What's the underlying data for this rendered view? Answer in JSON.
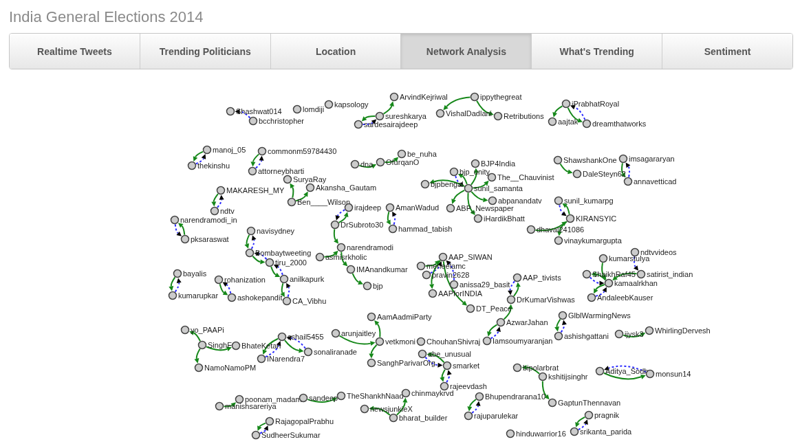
{
  "page_title": "India General Elections 2014",
  "tabs": [
    {
      "label": "Realtime Tweets",
      "selected": false
    },
    {
      "label": "Trending Politicians",
      "selected": false
    },
    {
      "label": "Location",
      "selected": false
    },
    {
      "label": "Network Analysis",
      "selected": true
    },
    {
      "label": "What's Trending",
      "selected": false
    },
    {
      "label": "Sentiment",
      "selected": false
    }
  ],
  "network": {
    "clusters": [
      {
        "label": "Shashwat014",
        "children": [
          {
            "label": "bcchristopher",
            "kind": "dashed"
          }
        ]
      },
      {
        "label": "lomdiji"
      },
      {
        "label": "kapsology"
      },
      {
        "label": "sureshkarya",
        "children": [
          {
            "label": "ArvindKejriwal",
            "kind": "solid"
          },
          {
            "label": "sardesairajdeep",
            "kind": "both"
          }
        ]
      },
      {
        "label": "ippythegreat",
        "children": [
          {
            "label": "VishalDadlani",
            "kind": "solid"
          },
          {
            "label": "Retributions",
            "kind": "solid"
          }
        ]
      },
      {
        "label": "iPrabhatRoyal",
        "children": [
          {
            "label": "aajtak",
            "kind": "solid"
          },
          {
            "label": "dreamthatworks",
            "kind": "both"
          }
        ]
      },
      {
        "label": "manoj_05",
        "children": [
          {
            "label": "thekinshu",
            "kind": "both"
          }
        ]
      },
      {
        "label": "commonm59784430",
        "children": [
          {
            "label": "attorneybharti",
            "kind": "both"
          }
        ]
      },
      {
        "label": "dna",
        "children": [
          {
            "label": "OfurqanO",
            "kind": "solid",
            "children": [
              {
                "label": "be_nuha",
                "kind": "solid"
              }
            ]
          }
        ]
      },
      {
        "label": "ShawshankOne",
        "children": [
          {
            "label": "DaleSteyn62",
            "kind": "solid"
          }
        ]
      },
      {
        "label": "imsagararyan",
        "children": [
          {
            "label": "annavetticad",
            "kind": "both"
          }
        ]
      },
      {
        "label": "MAKARESH_MY",
        "children": [
          {
            "label": "ndtv",
            "kind": "both"
          }
        ]
      },
      {
        "label": "Ben____Wilson",
        "children": [
          {
            "label": "SuryaRay",
            "kind": "solid"
          },
          {
            "label": "Akansha_Gautam",
            "kind": "solid"
          }
        ]
      },
      {
        "label": "sunil_samanta",
        "children": [
          {
            "label": "BJP4India",
            "kind": "solid"
          },
          {
            "label": "bjp_unity",
            "kind": "both"
          },
          {
            "label": "The__Chauvinist",
            "kind": "solid"
          },
          {
            "label": "bjpbengal",
            "kind": "solid"
          },
          {
            "label": "abpanandatv",
            "kind": "solid"
          },
          {
            "label": "ABP_Newspaper",
            "kind": "solid"
          },
          {
            "label": "iHardikBhatt",
            "kind": "solid"
          }
        ]
      },
      {
        "label": "pksaraswat",
        "children": [
          {
            "label": "narendramodi_in",
            "kind": "both"
          }
        ]
      },
      {
        "label": "DrSubroto30",
        "children": [
          {
            "label": "irajdeep",
            "kind": "both"
          },
          {
            "label": "narendramodi",
            "kind": "solid",
            "children": [
              {
                "label": "asmisrkholic",
                "kind": "reverse"
              },
              {
                "label": "IMAnandkumar",
                "kind": "solid",
                "children": [
                  {
                    "label": "bjp",
                    "kind": "solid"
                  }
                ]
              }
            ]
          }
        ]
      },
      {
        "label": "AmanWadud",
        "children": [
          {
            "label": "hammad_tabish",
            "kind": "both"
          }
        ]
      },
      {
        "label": "KIRANSYIC",
        "children": [
          {
            "label": "sunil_kumarpg",
            "kind": "both"
          },
          {
            "label": "dhaval241086",
            "kind": "reverse"
          },
          {
            "label": "vinaykumargupta",
            "kind": "solid"
          }
        ]
      },
      {
        "label": "bayalis",
        "children": [
          {
            "label": "kumarupkar",
            "kind": "both"
          }
        ]
      },
      {
        "label": "rohanization",
        "children": [
          {
            "label": "ashokepandit",
            "kind": "both"
          }
        ]
      },
      {
        "label": "navisydney",
        "children": [
          {
            "label": "Bombaytweeting",
            "kind": "both",
            "children": [
              {
                "label": "tiru_2000",
                "kind": "both",
                "children": [
                  {
                    "label": "anilkapurk",
                    "kind": "both",
                    "children": [
                      {
                        "label": "CA_Vibhu",
                        "kind": "both"
                      }
                    ]
                  }
                ]
              }
            ]
          }
        ]
      },
      {
        "label": "AAP_SIWAN",
        "children": [
          {
            "label": "meneelamc",
            "kind": "reverse"
          },
          {
            "label": "pravin2628",
            "kind": "dashed"
          },
          {
            "label": "anissa29_basit",
            "kind": "dashed"
          },
          {
            "label": "AAPforINDIA",
            "kind": "solid"
          },
          {
            "label": "DT_Peace",
            "kind": "solid"
          }
        ]
      },
      {
        "label": "kamaalrkhan",
        "children": [
          {
            "label": "kumarstulya",
            "kind": "reverse"
          },
          {
            "label": "ShaikhRaf45",
            "kind": "both"
          },
          {
            "label": "AndaleebKauser",
            "kind": "both"
          },
          {
            "label": "satirist_indian",
            "kind": "reverse",
            "children": [
              {
                "label": "ndtvvideos",
                "kind": "dashed"
              }
            ]
          }
        ]
      },
      {
        "label": "SinghF",
        "children": [
          {
            "label": "yo_PAAPi",
            "kind": "solid"
          },
          {
            "label": "BhateKetan",
            "kind": "solid"
          },
          {
            "label": "NamoNamoPM",
            "kind": "solid"
          }
        ]
      },
      {
        "label": "sshail5455",
        "children": [
          {
            "label": "INarendra7",
            "kind": "both"
          },
          {
            "label": "sonaliranade",
            "kind": "both"
          }
        ]
      },
      {
        "label": "arunjaitley",
        "children": [
          {
            "label": "vetkmoni",
            "kind": "solid",
            "children": [
              {
                "label": "AamAadmiParty",
                "kind": "solid"
              },
              {
                "label": "SanghParivarOrg",
                "kind": "solid"
              }
            ]
          }
        ]
      },
      {
        "label": "ChouhanShivraj"
      },
      {
        "label": "DrKumarVishwas",
        "children": [
          {
            "label": "AAP_tivists",
            "kind": "both"
          },
          {
            "label": "AzwarJahan",
            "kind": "reverse",
            "children": [
              {
                "label": "Iamsoumyaranjan",
                "kind": "both"
              }
            ]
          }
        ]
      },
      {
        "label": "GlblWarmingNews",
        "children": [
          {
            "label": "ashishgattani",
            "kind": "both"
          }
        ]
      },
      {
        "label": "ijysk3",
        "children": [
          {
            "label": "WhirlingDervesh",
            "kind": "solid"
          }
        ]
      },
      {
        "label": "smarket",
        "children": [
          {
            "label": "abe_unusual",
            "kind": "both"
          },
          {
            "label": "rajeevdash",
            "kind": "both"
          }
        ]
      },
      {
        "label": "kshitijsinghr",
        "children": [
          {
            "label": "bipolarbrat",
            "kind": "solid"
          },
          {
            "label": "GaptunThennavan",
            "kind": "solid"
          }
        ]
      },
      {
        "label": "Aditya_Sodh",
        "children": [
          {
            "label": "monsun14",
            "kind": "both"
          }
        ]
      },
      {
        "label": "manishsareriya",
        "children": [
          {
            "label": "poonam_madam",
            "kind": "solid"
          }
        ]
      },
      {
        "label": "sandeep",
        "children": [
          {
            "label": "TheShankhNaad",
            "kind": "solid"
          }
        ]
      },
      {
        "label": "bharat_builder",
        "children": [
          {
            "label": "chinmaykrvd",
            "kind": "solid"
          },
          {
            "label": "newsjunkieX",
            "kind": "solid"
          }
        ]
      },
      {
        "label": "Bhupendrarana10",
        "children": [
          {
            "label": "rajuparulekar",
            "kind": "both"
          }
        ]
      },
      {
        "label": "RajagopalPrabhu",
        "children": [
          {
            "label": "SudheerSukumar",
            "kind": "both"
          }
        ]
      },
      {
        "label": "hinduwarrior16"
      },
      {
        "label": "pragnik",
        "children": [
          {
            "label": "srikanta_parida",
            "kind": "both"
          }
        ]
      }
    ]
  }
}
